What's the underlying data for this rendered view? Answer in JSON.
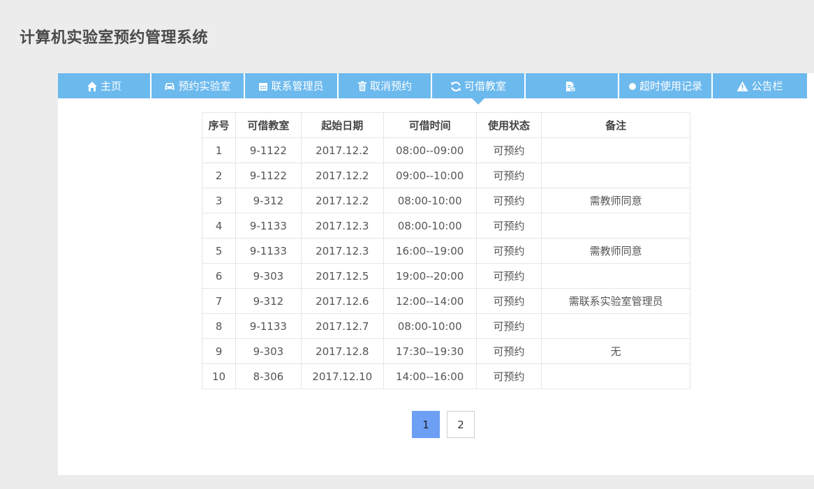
{
  "header": {
    "title": "计算机实验室预约管理系统"
  },
  "nav": {
    "items": [
      {
        "label": "主页",
        "icon": "home-icon"
      },
      {
        "label": "预约实验室",
        "icon": "car-icon"
      },
      {
        "label": "联系管理员",
        "icon": "calendar-icon"
      },
      {
        "label": "取消预约",
        "icon": "trash-icon"
      },
      {
        "label": "可借教室",
        "icon": "refresh-icon"
      },
      {
        "label": "",
        "icon": "document-icon"
      },
      {
        "label": "超时使用记录",
        "icon": "circle-icon"
      },
      {
        "label": "公告栏",
        "icon": "warning-icon"
      }
    ],
    "active_index": 4
  },
  "table": {
    "headers": [
      "序号",
      "可借教室",
      "起始日期",
      "可借时间",
      "使用状态",
      "备注"
    ],
    "rows": [
      [
        "1",
        "9-1122",
        "2017.12.2",
        "08:00--09:00",
        "可预约",
        ""
      ],
      [
        "2",
        "9-1122",
        "2017.12.2",
        "09:00--10:00",
        "可预约",
        ""
      ],
      [
        "3",
        "9-312",
        "2017.12.2",
        "08:00-10:00",
        "可预约",
        "需教师同意"
      ],
      [
        "4",
        "9-1133",
        "2017.12.3",
        "08:00-10:00",
        "可预约",
        ""
      ],
      [
        "5",
        "9-1133",
        "2017.12.3",
        "16:00--19:00",
        "可预约",
        "需教师同意"
      ],
      [
        "6",
        "9-303",
        "2017.12.5",
        "19:00--20:00",
        "可预约",
        ""
      ],
      [
        "7",
        "9-312",
        "2017.12.6",
        "12:00--14:00",
        "可预约",
        "需联系实验室管理员"
      ],
      [
        "8",
        "9-1133",
        "2017.12.7",
        "08:00-10:00",
        "可预约",
        ""
      ],
      [
        "9",
        "9-303",
        "2017.12.8",
        "17:30--19:30",
        "可预约",
        "无"
      ],
      [
        "10",
        "8-306",
        "2017.12.10",
        "14:00--16:00",
        "可预约",
        ""
      ]
    ]
  },
  "pagination": {
    "pages": [
      "1",
      "2"
    ],
    "current": "1"
  },
  "colors": {
    "nav_bg": "#6cb9ee",
    "page_active": "#6d9ff4",
    "background": "#ececec"
  }
}
